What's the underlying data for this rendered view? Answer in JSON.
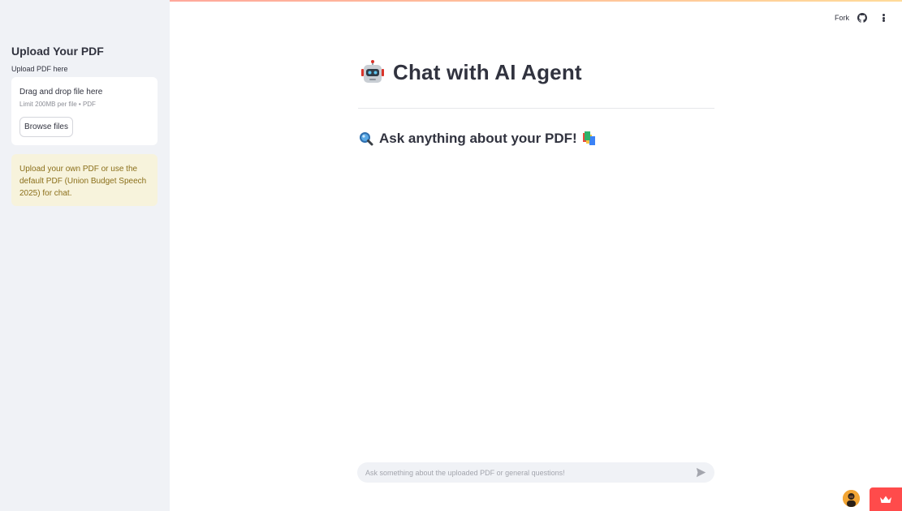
{
  "sidebar": {
    "title": "Upload Your PDF",
    "uploader_label": "Upload PDF here",
    "dropzone_text": "Drag and drop file here",
    "limit_text": "Limit 200MB per file • PDF",
    "browse_label": "Browse files",
    "info_text": "Upload your own PDF or use the default PDF (Union Budget Speech 2025) for chat."
  },
  "header": {
    "fork_label": "Fork",
    "github_icon": "github-icon",
    "menu_icon": "kebab-menu-icon"
  },
  "main": {
    "title": "Chat with AI Agent",
    "title_icon": "robot-icon",
    "subtitle": "Ask anything about your PDF!",
    "subtitle_icon_left": "magnifier-icon",
    "subtitle_icon_right": "books-icon"
  },
  "chat": {
    "placeholder": "Ask something about the uploaded PDF or general questions!",
    "send_icon": "send-icon"
  },
  "colors": {
    "accent": "#ff4b4b",
    "sidebar_bg": "#f0f2f6",
    "info_bg": "#f7f3dc",
    "info_text": "#8b6f1a",
    "text": "#31333f"
  }
}
